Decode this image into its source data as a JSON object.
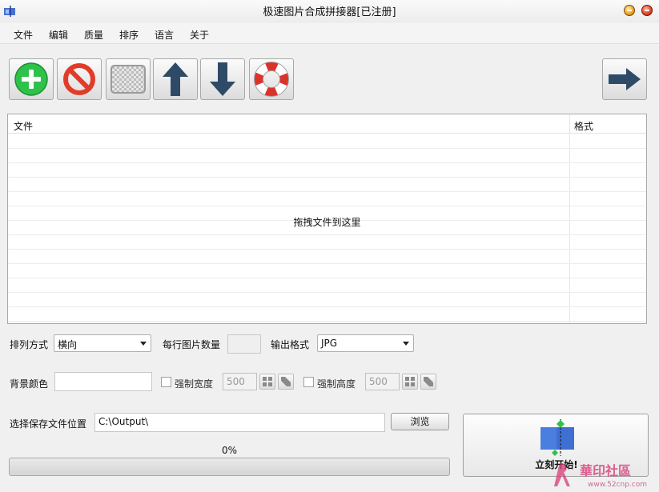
{
  "window": {
    "title": "极速图片合成拼接器[已注册]"
  },
  "menu": [
    "文件",
    "编辑",
    "质量",
    "排序",
    "语言",
    "关于"
  ],
  "toolbar": {
    "icons": [
      "add-icon",
      "remove-icon",
      "clear-icon",
      "move-up-icon",
      "move-down-icon",
      "help-icon",
      "next-icon"
    ]
  },
  "table": {
    "columns": [
      "文件",
      "格式"
    ],
    "rows": [],
    "empty_hint": "拖拽文件到这里"
  },
  "options": {
    "arrange_label": "排列方式",
    "arrange_value": "横向",
    "per_row_label": "每行图片数量",
    "per_row_value": "",
    "output_format_label": "输出格式",
    "output_format_value": "JPG",
    "bg_color_label": "背景颜色",
    "bg_color_value": "",
    "force_width_label": "强制宽度",
    "force_width_value": "500",
    "force_width_checked": false,
    "force_height_label": "强制高度",
    "force_height_value": "500",
    "force_height_checked": false
  },
  "save": {
    "label": "选择保存文件位置",
    "path": "C:\\Output\\",
    "browse_label": "浏览"
  },
  "progress": {
    "text": "0%",
    "value": 0
  },
  "start": {
    "label": "立刻开始!"
  },
  "watermark": {
    "text": "華印社區",
    "url": "www.52cnp.com"
  },
  "colors": {
    "add": "#2ec24a",
    "remove": "#e23b2a",
    "arrow": "#2f4a66",
    "lifebuoy": "#d9342b",
    "start": "#4a7fe0"
  }
}
